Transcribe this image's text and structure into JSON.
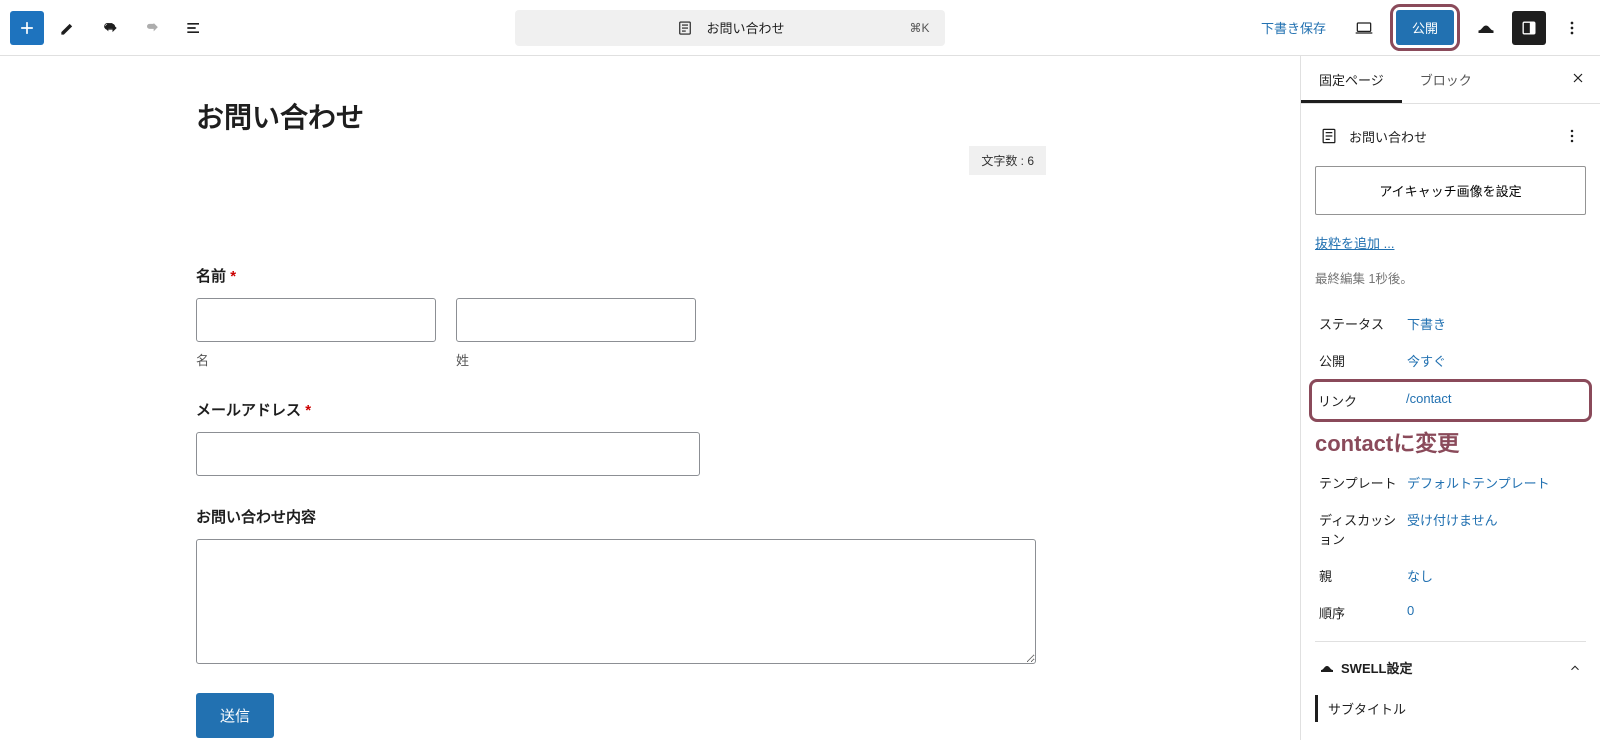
{
  "topbar": {
    "document_title": "お問い合わせ",
    "kbd_shortcut": "⌘K",
    "save_draft_label": "下書き保存",
    "publish_label": "公開"
  },
  "editor": {
    "page_title": "お問い合わせ",
    "char_count_label": "文字数 : 6",
    "form": {
      "name_label": "名前",
      "first_name_sublabel": "名",
      "last_name_sublabel": "姓",
      "email_label": "メールアドレス",
      "message_label": "お問い合わせ内容",
      "submit_label": "送信",
      "required_mark": "*"
    }
  },
  "sidebar": {
    "tabs": {
      "page": "固定ページ",
      "block": "ブロック"
    },
    "head_title": "お問い合わせ",
    "eyecatch_label": "アイキャッチ画像を設定",
    "excerpt_link": "抜粋を追加 ...",
    "last_edit": "最終編集 1秒後。",
    "status": {
      "label": "ステータス",
      "value": "下書き"
    },
    "publish": {
      "label": "公開",
      "value": "今すぐ"
    },
    "link": {
      "label": "リンク",
      "value": "/contact"
    },
    "annotation": "contactに変更",
    "template": {
      "label": "テンプレート",
      "value": "デフォルトテンプレート"
    },
    "discussion": {
      "label": "ディスカッション",
      "value": "受け付けません"
    },
    "parent": {
      "label": "親",
      "value": "なし"
    },
    "order": {
      "label": "順序",
      "value": "0"
    },
    "panel": {
      "title": "SWELL設定",
      "subtitle": "サブタイトル"
    }
  }
}
